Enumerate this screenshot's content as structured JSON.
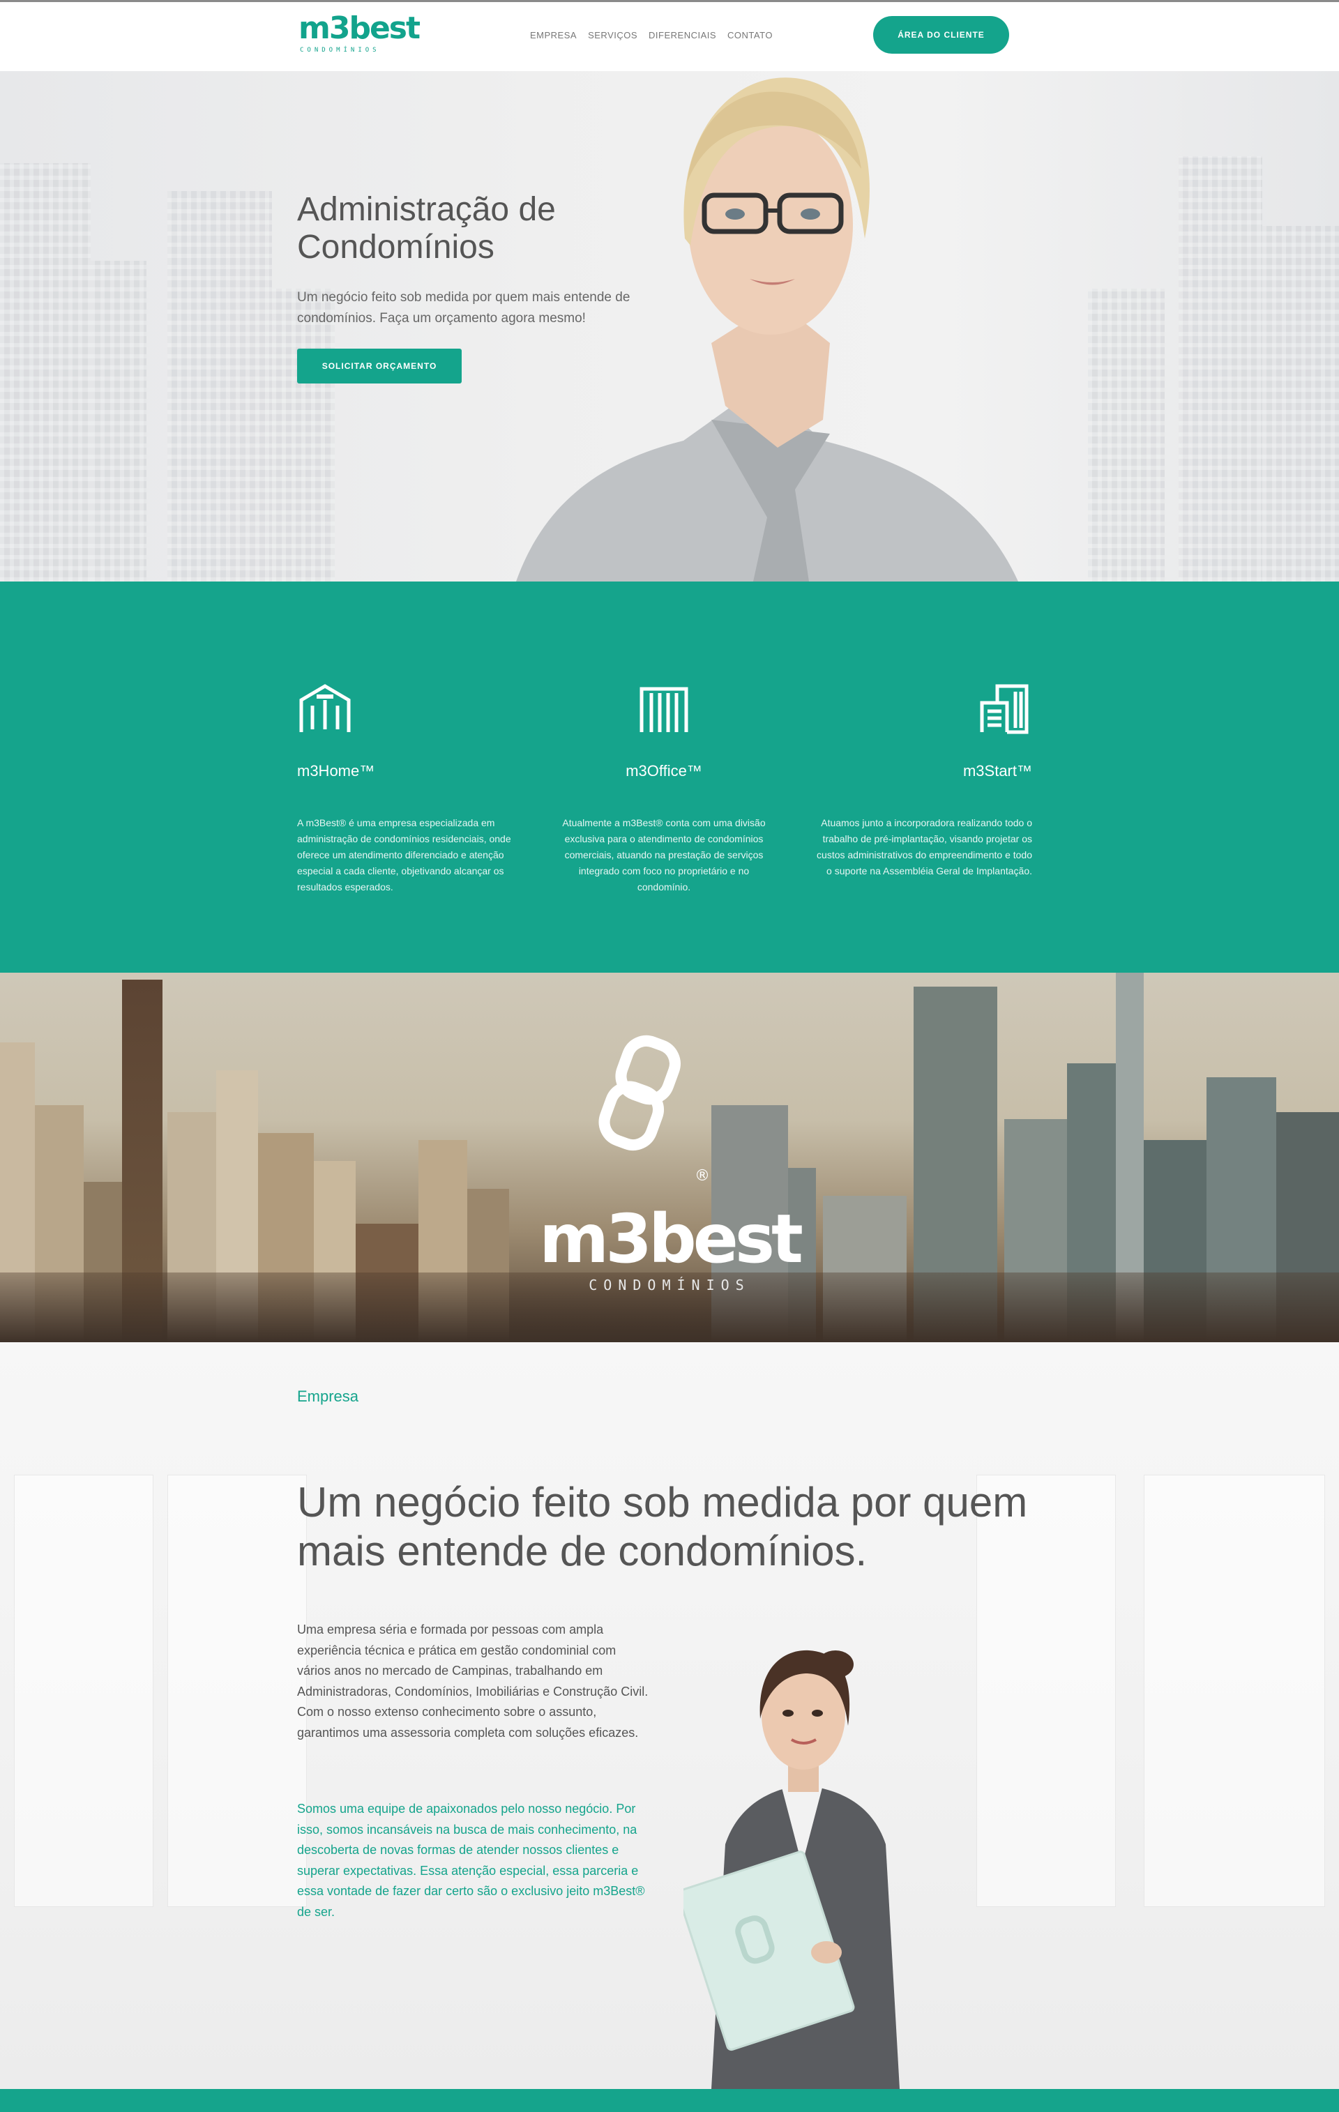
{
  "header": {
    "logo_text": "m3best",
    "logo_sub": "CONDOMÍNIOS",
    "nav": [
      "EMPRESA",
      "SERVIÇOS",
      "DIFERENCIAIS",
      "CONTATO"
    ],
    "client_button": "ÁREA DO CLIENTE"
  },
  "hero": {
    "title": "Administração de Condomínios",
    "text": "Um negócio feito sob medida por quem mais entende de condomínios. Faça um orçamento agora mesmo!",
    "button": "SOLICITAR ORÇAMENTO"
  },
  "services": [
    {
      "title": "m3Home™",
      "text": "A m3Best® é uma empresa especializada em administração de condomínios residenciais, onde oferece um atendimento diferenciado e atenção especial a cada cliente, objetivando alcançar os resultados esperados.",
      "icon": "residential-building-icon"
    },
    {
      "title": "m3Office™",
      "text": "Atualmente a m3Best® conta com uma divisão exclusiva para o atendimento de condomínios comerciais, atuando na prestação de serviços integrado com foco no proprietário e no condomínio.",
      "icon": "office-building-icon"
    },
    {
      "title": "m3Start™",
      "text": "Atuamos junto a incorporadora realizando todo o trabalho de pré-implantação, visando projetar os custos administrativos do empreendimento e todo o suporte na Assembléia Geral de Implantação.",
      "icon": "startup-building-icon"
    }
  ],
  "city_banner": {
    "logo_text": "m3best",
    "logo_sub": "CONDOMÍNIOS",
    "registered": "®"
  },
  "empresa": {
    "label": "Empresa",
    "title": "Um negócio feito sob medida por quem mais entende de condomínios.",
    "paragraph1": "Uma empresa séria e formada por pessoas com ampla experiência técnica e prática em gestão condominial com vários anos no mercado de Campinas, trabalhando em Administradoras, Condomínios, Imobiliárias e Construção Civil. Com o nosso extenso conhecimento sobre o assunto, garantimos uma assessoria completa com soluções eficazes.",
    "paragraph2": "Somos uma equipe de apaixonados pelo nosso negócio. Por isso, somos incansáveis na busca de mais conhecimento, na descoberta de novas formas de atender nossos clientes e superar expectativas. Essa atenção especial, essa parceria e essa vontade de fazer dar certo são o exclusivo jeito m3Best® de ser."
  },
  "colors": {
    "accent": "#15a48c",
    "text": "#555555"
  }
}
